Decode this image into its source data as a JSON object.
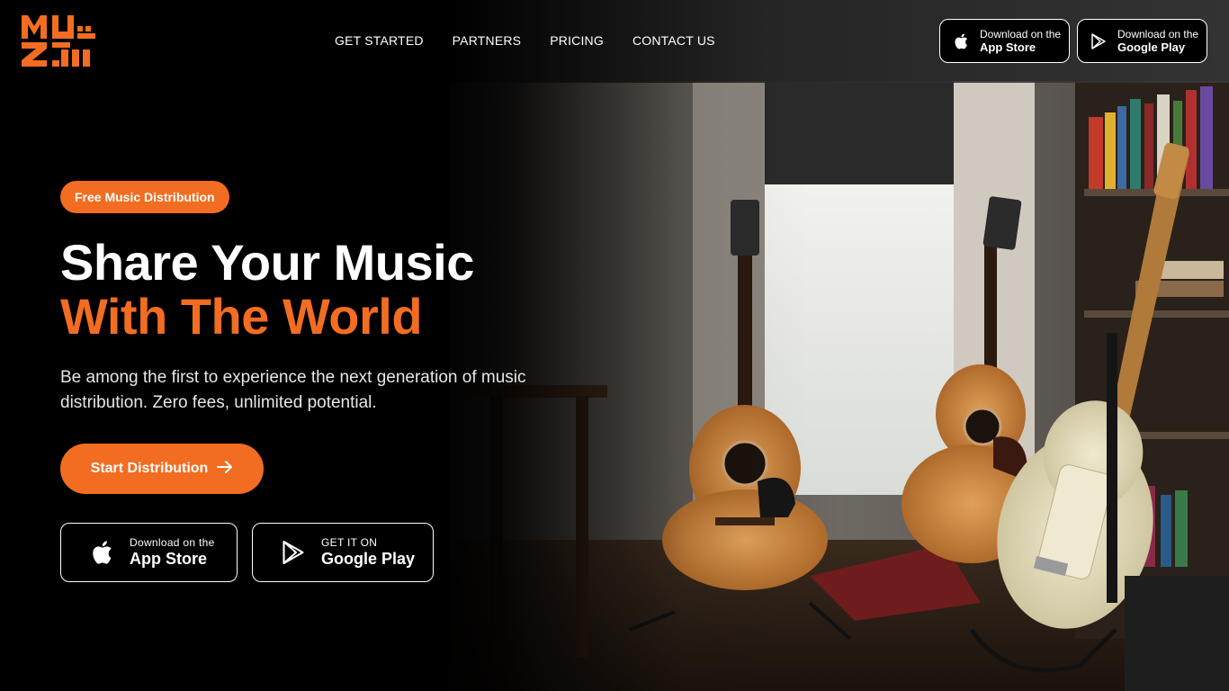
{
  "brand": {
    "logo_text": "MUZII",
    "accent_color": "#f26d21"
  },
  "nav": {
    "items": [
      {
        "label": "GET STARTED"
      },
      {
        "label": "PARTNERS"
      },
      {
        "label": "PRICING"
      },
      {
        "label": "CONTACT US"
      }
    ]
  },
  "header_stores": {
    "app_store": {
      "line1": "Download on the",
      "line2": "App Store",
      "icon": "apple-icon"
    },
    "google_play": {
      "line1": "Download on the",
      "line2": "Google Play",
      "icon": "google-play-icon"
    }
  },
  "hero": {
    "badge": "Free Music Distribution",
    "title_line1": "Share Your Music",
    "title_line2": "With The World",
    "subtitle": "Be among the first to experience the next generation of music distribution. Zero fees, unlimited potential.",
    "cta_label": "Start Distribution",
    "cta_icon": "arrow-right-icon"
  },
  "hero_stores": {
    "app_store": {
      "line1": "Download on the",
      "line2": "App Store",
      "icon": "apple-icon"
    },
    "google_play": {
      "line1": "GET IT ON",
      "line2": "Google Play",
      "icon": "google-play-icon"
    }
  },
  "background": {
    "subject": "guitars-in-room-photo"
  }
}
